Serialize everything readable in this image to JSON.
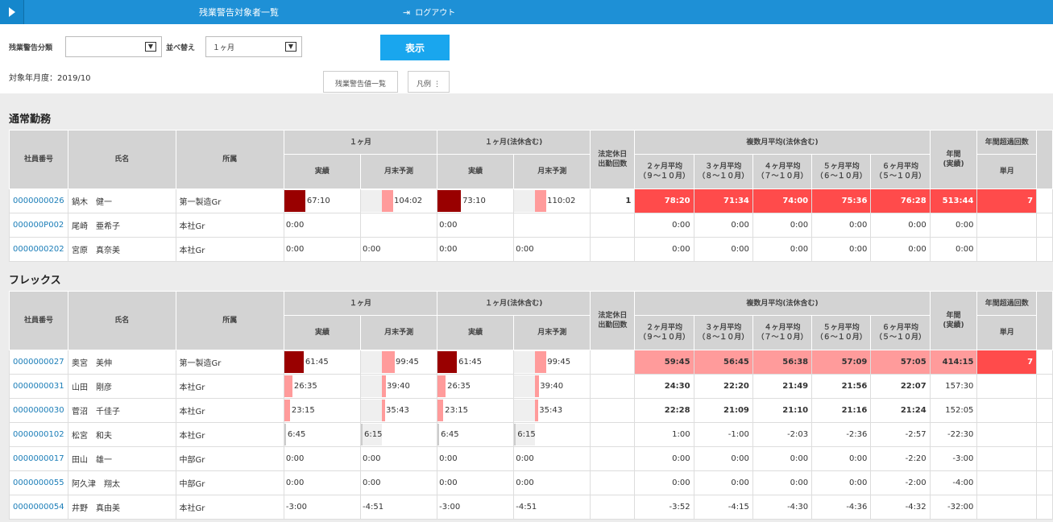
{
  "header": {
    "title": "残業警告対象者一覧",
    "logout_label": "ログアウト"
  },
  "filters": {
    "category_label": "残業警告分類",
    "category_value": "",
    "sort_label": "並べ替え",
    "sort_value": "１ヶ月",
    "show_button": "表示",
    "target_month": "対象年月度：2019/10",
    "threshold_tab": "残業警告値一覧",
    "legend_tab": "凡例"
  },
  "table_headers": {
    "emp_no": "社員番号",
    "name": "氏名",
    "dept": "所属",
    "month1": "１ヶ月",
    "month1_legal": "１ヶ月(法休含む)",
    "actual": "実績",
    "forecast": "月末予測",
    "holiday_l1": "法定休日",
    "holiday_l2": "出勤回数",
    "multi_avg": "複数月平均(法休含む)",
    "avg2_l1": "２ヶ月平均",
    "avg2_l2": "（９～１０月）",
    "avg3_l1": "３ヶ月平均",
    "avg3_l2": "（８～１０月）",
    "avg4_l1": "４ヶ月平均",
    "avg4_l2": "（７～１０月）",
    "avg5_l1": "５ヶ月平均",
    "avg5_l2": "（６～１０月）",
    "avg6_l1": "６ヶ月平均",
    "avg6_l2": "（５～１０月）",
    "annual_l1": "年間",
    "annual_l2": "(実績)",
    "exceed": "年間超過回数",
    "single": "単月"
  },
  "sections": [
    {
      "title": "通常勤務",
      "rows": [
        {
          "id": "0000000026",
          "name": "鍋木　健一",
          "dept": "第一製造Gr",
          "m_act": "67:10",
          "m_fc": "104:02",
          "l_act": "73:10",
          "l_fc": "110:02",
          "hol": "1",
          "a2": "78:20",
          "a3": "71:34",
          "a4": "74:00",
          "a5": "75:36",
          "a6": "76:28",
          "annual": "513:44",
          "single": "7"
        },
        {
          "id": "000000P002",
          "name": "尾崎　亜希子",
          "dept": "本社Gr",
          "m_act": "0:00",
          "m_fc": "",
          "l_act": "0:00",
          "l_fc": "",
          "hol": "",
          "a2": "0:00",
          "a3": "0:00",
          "a4": "0:00",
          "a5": "0:00",
          "a6": "0:00",
          "annual": "0:00",
          "single": ""
        },
        {
          "id": "0000000202",
          "name": "宮原　真奈美",
          "dept": "本社Gr",
          "m_act": "0:00",
          "m_fc": "0:00",
          "l_act": "0:00",
          "l_fc": "0:00",
          "hol": "",
          "a2": "0:00",
          "a3": "0:00",
          "a4": "0:00",
          "a5": "0:00",
          "a6": "0:00",
          "annual": "0:00",
          "single": ""
        }
      ]
    },
    {
      "title": "フレックス",
      "rows": [
        {
          "id": "0000000027",
          "name": "奥宮　美伸",
          "dept": "第一製造Gr",
          "m_act": "61:45",
          "m_fc": "99:45",
          "l_act": "61:45",
          "l_fc": "99:45",
          "hol": "",
          "a2": "59:45",
          "a3": "56:45",
          "a4": "56:38",
          "a5": "57:09",
          "a6": "57:05",
          "annual": "414:15",
          "single": "7"
        },
        {
          "id": "0000000031",
          "name": "山田　剛彦",
          "dept": "本社Gr",
          "m_act": "26:35",
          "m_fc": "39:40",
          "l_act": "26:35",
          "l_fc": "39:40",
          "hol": "",
          "a2": "24:30",
          "a3": "22:20",
          "a4": "21:49",
          "a5": "21:56",
          "a6": "22:07",
          "annual": "157:30",
          "single": ""
        },
        {
          "id": "0000000030",
          "name": "菅沼　千佳子",
          "dept": "本社Gr",
          "m_act": "23:15",
          "m_fc": "35:43",
          "l_act": "23:15",
          "l_fc": "35:43",
          "hol": "",
          "a2": "22:28",
          "a3": "21:09",
          "a4": "21:10",
          "a5": "21:16",
          "a6": "21:24",
          "annual": "152:05",
          "single": ""
        },
        {
          "id": "0000000102",
          "name": "松宮　和夫",
          "dept": "本社Gr",
          "m_act": "6:45",
          "m_fc": "6:15",
          "l_act": "6:45",
          "l_fc": "6:15",
          "hol": "",
          "a2": "1:00",
          "a3": "-1:00",
          "a4": "-2:03",
          "a5": "-2:36",
          "a6": "-2:57",
          "annual": "-22:30",
          "single": ""
        },
        {
          "id": "0000000017",
          "name": "田山　雄一",
          "dept": "中部Gr",
          "m_act": "0:00",
          "m_fc": "0:00",
          "l_act": "0:00",
          "l_fc": "0:00",
          "hol": "",
          "a2": "0:00",
          "a3": "0:00",
          "a4": "0:00",
          "a5": "0:00",
          "a6": "-2:20",
          "annual": "-3:00",
          "single": ""
        },
        {
          "id": "0000000055",
          "name": "阿久津　翔太",
          "dept": "中部Gr",
          "m_act": "0:00",
          "m_fc": "0:00",
          "l_act": "0:00",
          "l_fc": "0:00",
          "hol": "",
          "a2": "0:00",
          "a3": "0:00",
          "a4": "0:00",
          "a5": "0:00",
          "a6": "-2:00",
          "annual": "-4:00",
          "single": ""
        },
        {
          "id": "0000000054",
          "name": "井野　真由美",
          "dept": "本社Gr",
          "m_act": "-3:00",
          "m_fc": "-4:51",
          "l_act": "-3:00",
          "l_fc": "-4:51",
          "hol": "",
          "a2": "-3:52",
          "a3": "-4:15",
          "a4": "-4:30",
          "a5": "-4:36",
          "a6": "-4:32",
          "annual": "-32:00",
          "single": ""
        }
      ]
    }
  ],
  "colors": {
    "header_bar": "#1e90d6",
    "button": "#19a6ee",
    "alert_strong": "#ff4b4b",
    "alert_light": "#ff9b9b",
    "bar_dark": "#990000",
    "bar_light": "#ff9b9b",
    "link": "#1a7db8"
  }
}
